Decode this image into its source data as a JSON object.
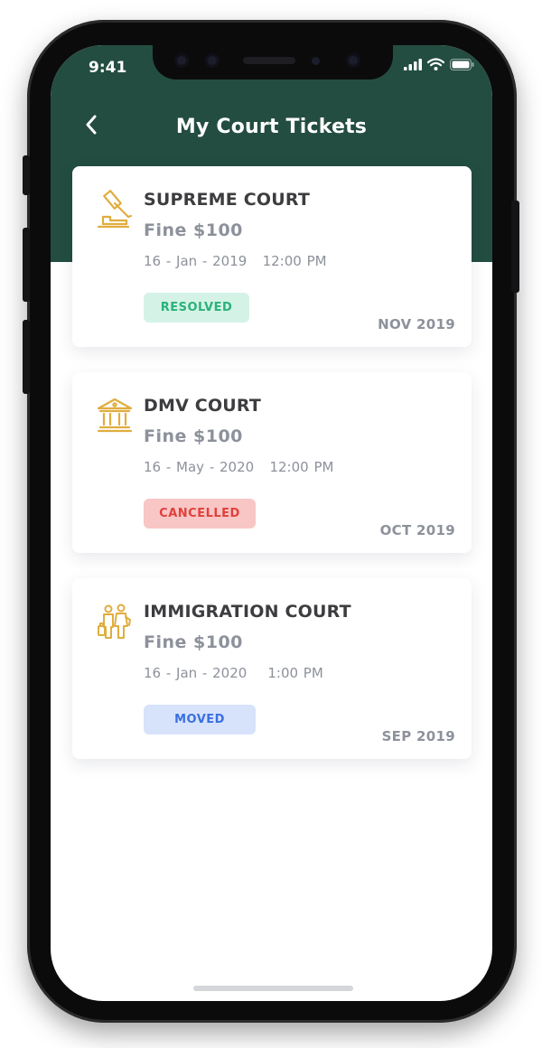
{
  "status_bar": {
    "time": "9:41"
  },
  "header": {
    "title": "My Court Tickets",
    "background_color": "#234d40"
  },
  "tickets": [
    {
      "court": "SUPREME COURT",
      "fine": "Fine $100",
      "datetime": "16 - Jan - 2019   12:00 PM",
      "status": "RESOLVED",
      "status_color": "#2bb17b",
      "month": "NOV 2019",
      "icon": "gavel-icon"
    },
    {
      "court": "DMV COURT",
      "fine": "Fine $100",
      "datetime": "16 - May - 2020   12:00 PM",
      "status": "CANCELLED",
      "status_color": "#e0413a",
      "month": "OCT 2019",
      "icon": "courthouse-icon"
    },
    {
      "court": "IMMIGRATION COURT",
      "fine": "Fine $100",
      "datetime": "16 - Jan - 2020    1:00 PM",
      "status": "MOVED",
      "status_color": "#3a6fe0",
      "month": "SEP 2019",
      "icon": "immigrants-icon"
    }
  ],
  "accent_icon_color": "#e0ad3e"
}
